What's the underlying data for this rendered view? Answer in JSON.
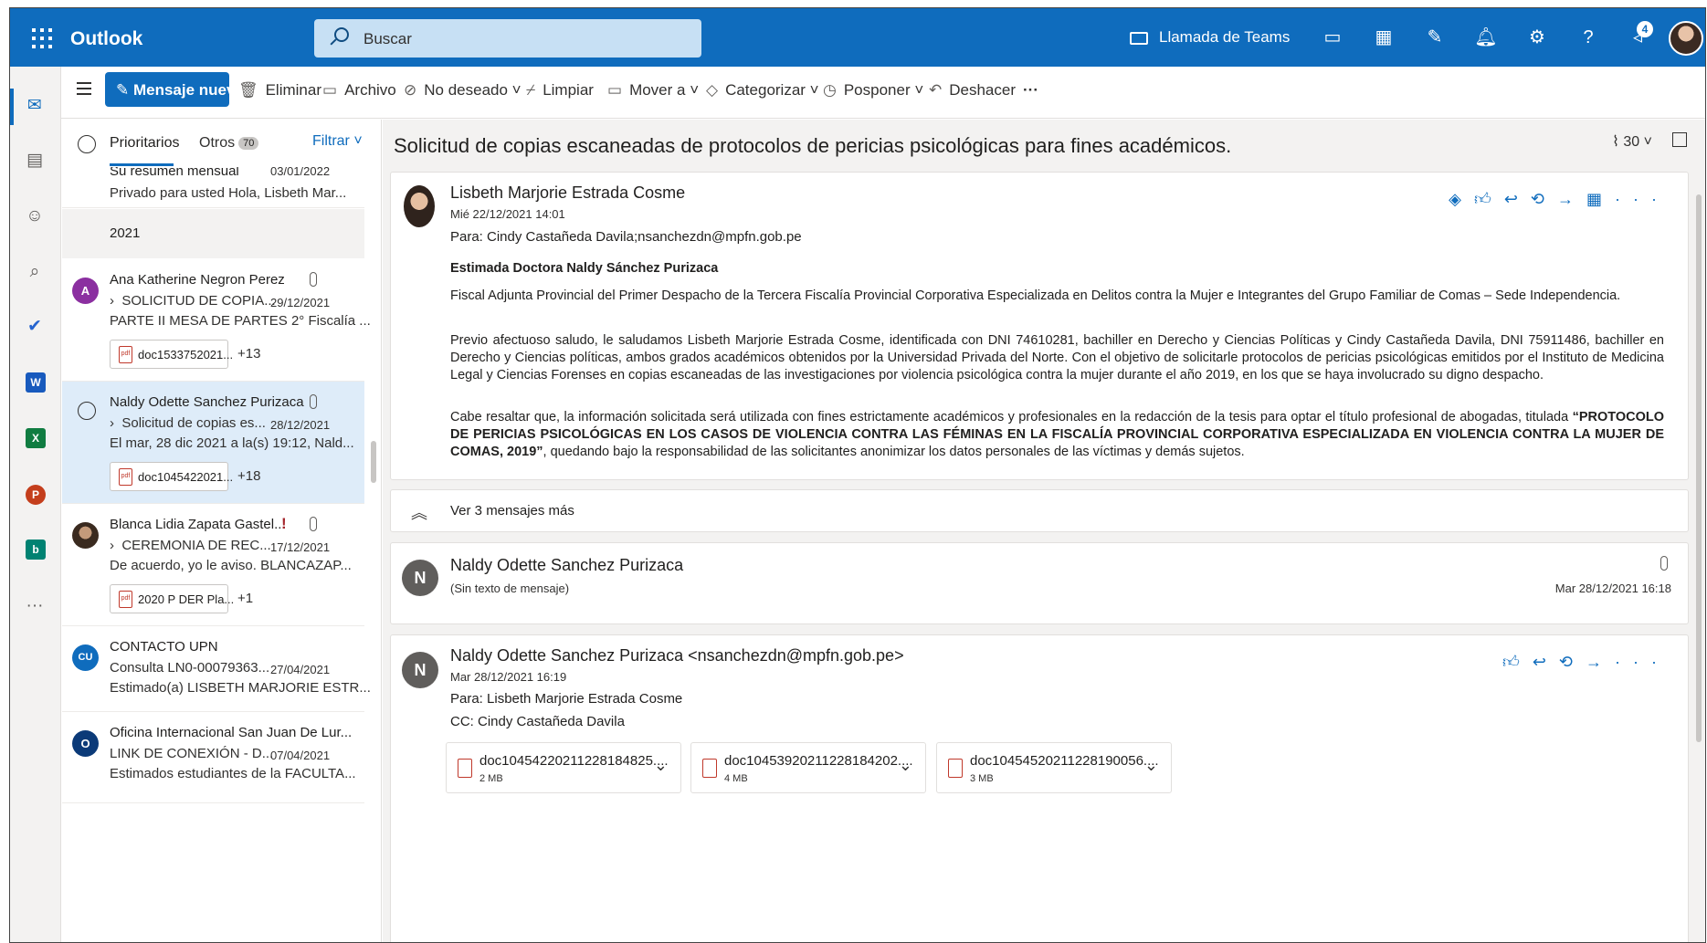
{
  "app": {
    "name": "Outlook",
    "search_placeholder": "Buscar",
    "teams_call": "Llamada de Teams",
    "notif_count": "4",
    "accent": "#0f6cbd"
  },
  "toolbar": {
    "new_message": "Mensaje nuevo",
    "delete": "Eliminar",
    "archive": "Archivo",
    "junk": "No deseado",
    "sweep": "Limpiar",
    "move": "Mover a",
    "categorize": "Categorizar",
    "snooze": "Posponer",
    "undo": "Deshacer",
    "more": "···"
  },
  "list": {
    "tab_focused": "Prioritarios",
    "tab_other": "Otros",
    "other_count": "70",
    "filter": "Filtrar",
    "top_item": {
      "subject": "Su resumen mensual",
      "date": "03/01/2022",
      "preview": "Privado para usted Hola, Lisbeth Mar..."
    },
    "year_header": "2021",
    "items": [
      {
        "initials": "A",
        "color": "#8b2fa0",
        "from": "Ana Katherine Negron Perez",
        "subject": "SOLICITUD DE COPIA...",
        "date": "29/12/2021",
        "preview": "PARTE II MESA DE PARTES 2° Fiscalía ...",
        "attachment": "doc1533752021...",
        "more": "+13"
      },
      {
        "initials": "",
        "color": "",
        "from": "Naldy Odette Sanchez Purizaca",
        "subject": "Solicitud de copias es...",
        "date": "28/12/2021",
        "preview": "El mar, 28 dic 2021 a la(s) 19:12, Nald...",
        "attachment": "doc1045422021...",
        "more": "+18"
      },
      {
        "initials": "",
        "color": "#3a2a1f",
        "from": "Blanca Lidia Zapata Gastel...",
        "subject": "CEREMONIA DE REC...",
        "date": "17/12/2021",
        "preview": "De acuerdo, yo le aviso. BLANCAZAP...",
        "attachment": "2020 P DER Pla...",
        "more": "+1"
      },
      {
        "initials": "CU",
        "color": "#0f6cbd",
        "from": "CONTACTO UPN",
        "subject": "Consulta LN0-00079363...",
        "date": "27/04/2021",
        "preview": "Estimado(a) LISBETH MARJORIE ESTR..."
      },
      {
        "initials": "O",
        "color": "#0b3a78",
        "from": "Oficina Internacional San Juan De Lur...",
        "subject": "LINK DE CONEXIÓN - D...",
        "date": "07/04/2021",
        "preview": "Estimados estudiantes de la FACULTA..."
      }
    ]
  },
  "reading": {
    "title": "Solicitud de copias escaneadas de protocolos de pericias psicológicas para fines académicos.",
    "count": "30",
    "msg1": {
      "from": "Lisbeth Marjorie Estrada Cosme",
      "date": "Mié 22/12/2021 14:01",
      "to": "Para: Cindy Castañeda Davila;nsanchezdn@mpfn.gob.pe",
      "greeting": "Estimada Doctora Naldy Sánchez Purizaca",
      "p1": "Fiscal Adjunta Provincial del Primer Despacho de la Tercera Fiscalía Provincial Corporativa Especializada en Delitos contra la Mujer e Integrantes del Grupo Familiar de Comas – Sede Independencia.",
      "p2": "Previo afectuoso saludo, le saludamos Lisbeth Marjorie Estrada Cosme, identificada con DNI 74610281, bachiller en Derecho y Ciencias Políticas y Cindy Castañeda Davila, DNI 75911486, bachiller en Derecho y Ciencias políticas, ambos grados académicos obtenidos por la Universidad Privada del Norte. Con el objetivo de solicitarle protocolos de pericias psicológicas emitidos por el Instituto de Medicina Legal y Ciencias Forenses en copias escaneadas de las investigaciones por violencia psicológica contra la mujer durante el año 2019, en los que se haya involucrado su digno despacho.",
      "p3a": "Cabe resaltar que, la información solicitada será utilizada con fines estrictamente académicos y profesionales en la redacción de la tesis para optar el título profesional de abogadas, titulada ",
      "p3b": "“PROTOCOLO DE PERICIAS PSICOLÓGICAS EN LOS CASOS DE VIOLENCIA CONTRA LAS FÉMINAS EN LA FISCALÍA PROVINCIAL CORPORATIVA ESPECIALIZADA EN VIOLENCIA CONTRA LA MUJER DE COMAS, 2019”",
      "p3c": ", quedando bajo la responsabilidad de las solicitantes anonimizar los datos personales de las víctimas y demás sujetos."
    },
    "see_more": "Ver 3 mensajes más",
    "msg2": {
      "initial": "N",
      "from": "Naldy Odette Sanchez Purizaca",
      "note": "(Sin texto de mensaje)",
      "date": "Mar 28/12/2021 16:18"
    },
    "msg3": {
      "initial": "N",
      "from": "Naldy Odette Sanchez Purizaca <nsanchezdn@mpfn.gob.pe>",
      "date": "Mar 28/12/2021 16:19",
      "to": "Para: Lisbeth Marjorie Estrada Cosme",
      "cc": "CC: Cindy Castañeda Davila",
      "attachments": [
        {
          "name": "doc10454220211228184825....",
          "size": "2 MB"
        },
        {
          "name": "doc10453920211228184202....",
          "size": "4 MB"
        },
        {
          "name": "doc10454520211228190056....",
          "size": "3 MB"
        }
      ]
    }
  }
}
